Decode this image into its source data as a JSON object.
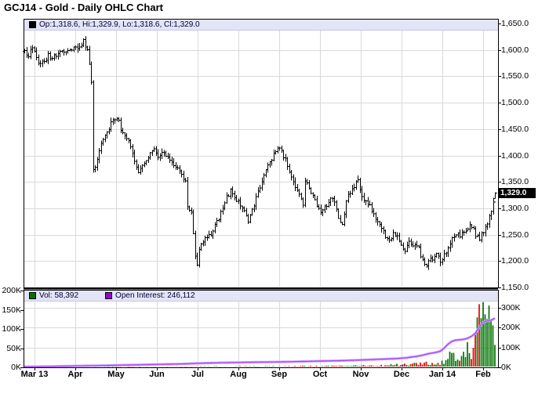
{
  "title": "GCJ14 - Gold - Daily OHLC Chart",
  "main_legend": {
    "swatch_color": "#000000",
    "text": "Op:1,318.6, Hi:1,329.9, Lo:1,318.6, Cl:1,329.0"
  },
  "volume_legend": {
    "vol_swatch_color": "#007300",
    "vol_text": "Vol: 58,392",
    "oi_swatch_color": "#9900cc",
    "oi_text": "Open Interest: 246,112"
  },
  "last_price_marker": "1,329.0",
  "colors": {
    "bar": "#000000",
    "up_volume": "#007400",
    "down_volume": "#e60000",
    "neutral_volume": "#000080",
    "oi_line": "#a64dff",
    "oi_halo": "#d4a8ff",
    "grid": "#d9d9d9",
    "legend_bg": "#e4e4f8",
    "border": "#000000"
  },
  "chart_data": {
    "type": "ohlc",
    "title": "GCJ14 - Gold - Daily OHLC Chart",
    "instrument": "GCJ14 - Gold",
    "last_bar": {
      "open": 1318.6,
      "high": 1329.9,
      "low": 1318.6,
      "close": 1329.0
    },
    "last_volume": 58392,
    "last_open_interest": 246112,
    "price_axis": {
      "side": "right",
      "ylim": [
        1150,
        1650
      ],
      "ticks": [
        {
          "v": 1650,
          "label": "1,650.0"
        },
        {
          "v": 1600,
          "label": "1,600.0"
        },
        {
          "v": 1550,
          "label": "1,550.0"
        },
        {
          "v": 1500,
          "label": "1,500.0"
        },
        {
          "v": 1450,
          "label": "1,450.0"
        },
        {
          "v": 1400,
          "label": "1,400.0"
        },
        {
          "v": 1350,
          "label": "1,350.0"
        },
        {
          "v": 1300,
          "label": "1,300.0"
        },
        {
          "v": 1250,
          "label": "1,250.0"
        },
        {
          "v": 1200,
          "label": "1,200.0"
        },
        {
          "v": 1150,
          "label": "1,150.0"
        }
      ]
    },
    "x_axis": {
      "months": [
        "Mar 13",
        "Apr",
        "May",
        "Jun",
        "Jul",
        "Aug",
        "Sep",
        "Oct",
        "Nov",
        "Dec",
        "Jan 14",
        "Feb"
      ]
    },
    "volume_axis_left": {
      "ylim_k": [
        0,
        200
      ],
      "ticks": [
        {
          "v": 200,
          "label": "200K"
        },
        {
          "v": 150,
          "label": "150K"
        },
        {
          "v": 100,
          "label": "100K"
        },
        {
          "v": 50,
          "label": "50K"
        },
        {
          "v": 0,
          "label": "0K"
        }
      ]
    },
    "volume_axis_right": {
      "ylim_k": [
        0,
        388
      ],
      "ticks": [
        {
          "v": 300,
          "label": "300K"
        },
        {
          "v": 200,
          "label": "200K"
        },
        {
          "v": 100,
          "label": "100K"
        },
        {
          "v": 0,
          "label": "0K"
        }
      ]
    },
    "grid": true,
    "price_close_anchors": [
      [
        0,
        1595
      ],
      [
        2,
        1586
      ],
      [
        4,
        1608
      ],
      [
        6,
        1582
      ],
      [
        8,
        1572
      ],
      [
        10,
        1578
      ],
      [
        12,
        1590
      ],
      [
        14,
        1583
      ],
      [
        16,
        1592
      ],
      [
        18,
        1600
      ],
      [
        20,
        1598
      ],
      [
        23,
        1604
      ],
      [
        26,
        1601
      ],
      [
        28,
        1608
      ],
      [
        30,
        1615
      ],
      [
        32,
        1600
      ],
      [
        33,
        1575
      ],
      [
        34,
        1535
      ],
      [
        35,
        1372
      ],
      [
        36,
        1380
      ],
      [
        37,
        1390
      ],
      [
        39,
        1420
      ],
      [
        41,
        1438
      ],
      [
        43,
        1452
      ],
      [
        45,
        1468
      ],
      [
        47,
        1472
      ],
      [
        49,
        1452
      ],
      [
        51,
        1440
      ],
      [
        53,
        1425
      ],
      [
        55,
        1405
      ],
      [
        57,
        1380
      ],
      [
        58,
        1365
      ],
      [
        60,
        1385
      ],
      [
        62,
        1393
      ],
      [
        64,
        1405
      ],
      [
        66,
        1412
      ],
      [
        68,
        1400
      ],
      [
        70,
        1408
      ],
      [
        72,
        1402
      ],
      [
        74,
        1390
      ],
      [
        76,
        1383
      ],
      [
        78,
        1372
      ],
      [
        80,
        1365
      ],
      [
        82,
        1350
      ],
      [
        83,
        1302
      ],
      [
        84,
        1295
      ],
      [
        85,
        1288
      ],
      [
        86,
        1252
      ],
      [
        87,
        1205
      ],
      [
        88,
        1192
      ],
      [
        89,
        1222
      ],
      [
        91,
        1240
      ],
      [
        93,
        1248
      ],
      [
        95,
        1252
      ],
      [
        97,
        1270
      ],
      [
        99,
        1282
      ],
      [
        101,
        1298
      ],
      [
        103,
        1322
      ],
      [
        105,
        1332
      ],
      [
        107,
        1318
      ],
      [
        109,
        1312
      ],
      [
        111,
        1300
      ],
      [
        113,
        1282
      ],
      [
        114,
        1275
      ],
      [
        116,
        1295
      ],
      [
        118,
        1318
      ],
      [
        120,
        1340
      ],
      [
        122,
        1362
      ],
      [
        124,
        1378
      ],
      [
        126,
        1395
      ],
      [
        128,
        1408
      ],
      [
        129,
        1418
      ],
      [
        131,
        1408
      ],
      [
        133,
        1392
      ],
      [
        135,
        1372
      ],
      [
        137,
        1352
      ],
      [
        139,
        1335
      ],
      [
        141,
        1318
      ],
      [
        142,
        1308
      ],
      [
        143,
        1352
      ],
      [
        145,
        1338
      ],
      [
        147,
        1322
      ],
      [
        149,
        1305
      ],
      [
        151,
        1292
      ],
      [
        153,
        1300
      ],
      [
        155,
        1312
      ],
      [
        157,
        1320
      ],
      [
        159,
        1295
      ],
      [
        161,
        1275
      ],
      [
        162,
        1268
      ],
      [
        163,
        1285
      ],
      [
        164,
        1315
      ],
      [
        166,
        1330
      ],
      [
        168,
        1342
      ],
      [
        170,
        1350
      ],
      [
        171,
        1340
      ],
      [
        172,
        1318
      ],
      [
        174,
        1312
      ],
      [
        176,
        1305
      ],
      [
        178,
        1288
      ],
      [
        180,
        1278
      ],
      [
        182,
        1262
      ],
      [
        184,
        1246
      ],
      [
        186,
        1242
      ],
      [
        188,
        1252
      ],
      [
        190,
        1246
      ],
      [
        192,
        1232
      ],
      [
        194,
        1222
      ],
      [
        196,
        1242
      ],
      [
        198,
        1230
      ],
      [
        200,
        1232
      ],
      [
        202,
        1212
      ],
      [
        204,
        1190
      ],
      [
        206,
        1198
      ],
      [
        208,
        1206
      ],
      [
        210,
        1214
      ],
      [
        212,
        1202
      ],
      [
        214,
        1210
      ],
      [
        216,
        1228
      ],
      [
        218,
        1242
      ],
      [
        220,
        1252
      ],
      [
        222,
        1248
      ],
      [
        224,
        1258
      ],
      [
        226,
        1262
      ],
      [
        228,
        1268
      ],
      [
        230,
        1250
      ],
      [
        232,
        1242
      ],
      [
        233,
        1252
      ],
      [
        234,
        1256
      ],
      [
        235,
        1262
      ],
      [
        236,
        1270
      ],
      [
        237,
        1282
      ],
      [
        238,
        1296
      ],
      [
        239,
        1310
      ],
      [
        240,
        1329
      ]
    ],
    "volume_anchors_k": [
      [
        0,
        1.5
      ],
      [
        40,
        1.5
      ],
      [
        80,
        2
      ],
      [
        120,
        2.5
      ],
      [
        150,
        3
      ],
      [
        170,
        4
      ],
      [
        185,
        5
      ],
      [
        192,
        7
      ],
      [
        196,
        6
      ],
      [
        200,
        9
      ],
      [
        204,
        12
      ],
      [
        208,
        9
      ],
      [
        212,
        11
      ],
      [
        214,
        16
      ],
      [
        216,
        26
      ],
      [
        218,
        38
      ],
      [
        220,
        20
      ],
      [
        222,
        16
      ],
      [
        224,
        34
      ],
      [
        226,
        45
      ],
      [
        228,
        30
      ],
      [
        229,
        60
      ],
      [
        230,
        70
      ],
      [
        231,
        110
      ],
      [
        232,
        150
      ],
      [
        233,
        115
      ],
      [
        234,
        150
      ],
      [
        235,
        160
      ],
      [
        236,
        130
      ],
      [
        237,
        148
      ],
      [
        238,
        152
      ],
      [
        239,
        145
      ],
      [
        240,
        58.4
      ]
    ],
    "neutral_volume_day": 193,
    "open_interest_anchors_k": [
      [
        0,
        3
      ],
      [
        10,
        4
      ],
      [
        20,
        6
      ],
      [
        40,
        9
      ],
      [
        60,
        13
      ],
      [
        80,
        17
      ],
      [
        88,
        20
      ],
      [
        100,
        23
      ],
      [
        120,
        26
      ],
      [
        130,
        27
      ],
      [
        140,
        29
      ],
      [
        150,
        31
      ],
      [
        160,
        33
      ],
      [
        170,
        36
      ],
      [
        180,
        40
      ],
      [
        190,
        44
      ],
      [
        195,
        48
      ],
      [
        200,
        55
      ],
      [
        203,
        60
      ],
      [
        206,
        68
      ],
      [
        210,
        75
      ],
      [
        212,
        80
      ],
      [
        214,
        95
      ],
      [
        216,
        115
      ],
      [
        218,
        130
      ],
      [
        220,
        136
      ],
      [
        222,
        138
      ],
      [
        224,
        140
      ],
      [
        226,
        145
      ],
      [
        228,
        155
      ],
      [
        230,
        170
      ],
      [
        231,
        185
      ],
      [
        232,
        200
      ],
      [
        233,
        215
      ],
      [
        234,
        225
      ],
      [
        235,
        230
      ],
      [
        236,
        232
      ],
      [
        237,
        234
      ],
      [
        238,
        236
      ],
      [
        239,
        240
      ],
      [
        240,
        246
      ]
    ]
  }
}
